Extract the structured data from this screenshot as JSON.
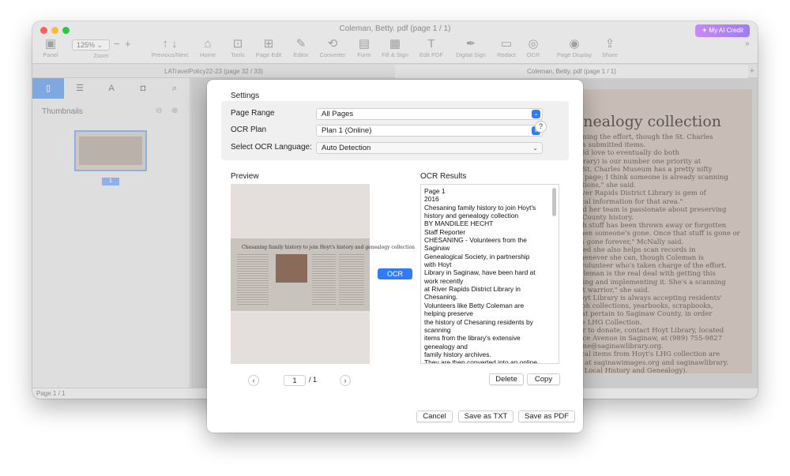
{
  "window": {
    "title": "Coleman, Betty. pdf (page 1 / 1)",
    "ai_credit": "My AI Credit",
    "toolbar": {
      "panel": "Panel",
      "zoom_label": "Zoom",
      "zoom_value": "125%",
      "zoom_minus": "−",
      "zoom_plus": "+",
      "prev_next": "Previous/Next",
      "home": "Home",
      "tools": "Tools",
      "page_edit": "Page Edit",
      "editor": "Editor",
      "converter": "Converter",
      "form": "Form",
      "fill_sign": "Fill & Sign",
      "edit_pdf": "Edit PDF",
      "digital_sign": "Digital Sign",
      "redact": "Redact",
      "ocr": "OCR",
      "page_display": "Page Display",
      "share": "Share"
    },
    "tabs": [
      "LATravelPolicy22-23 (page 32 / 33)",
      "Coleman, Betty. pdf (page 1 / 1)"
    ],
    "tab_add": "+",
    "sidebar": {
      "thumbnails_label": "Thumbnails",
      "thumb_page_number": "1"
    },
    "document": {
      "heading": "enealogy collection",
      "lines": [
        "joining the effort, though the St. Charles",
        "has submitted items.",
        "ould love to eventually do both",
        "library) is our number one priority at",
        "e, St. Charles Museum has a pretty nifty",
        "ok page; I think someone is already scanning",
        "ections,\" she said.",
        "River Rapids District Library is gem of",
        "gical information for that area.\"",
        "and her team is passionate about preserving",
        "w County history.",
        "uch stuff has been thrown away or forgotten",
        "when someone's gone. Once that stuff is gone or",
        "it's gone forever,\" McNally said.",
        "dded she also helps scan records in",
        "whenever she can, though Coleman is",
        "n volunteer who's taken charge of the effort.",
        "Coleman is the real deal with getting this",
        "going and implementing it. She's a scanning",
        "ent warrior,\" she said.",
        "Hoyt Library is always accepting residents'",
        "raph collections, yearbooks, scrapbooks,",
        "that pertain to Saginaw County, in order",
        "the LHG Collection.",
        "der to donate, contact Hoyt Library, located",
        "ance Avenue in Saginaw, at (989) 755-9827",
        "gene@saginawlibrary.org.",
        "gical items from Hoyt's LHG collection are",
        "ed at saginawimages.org and saginawlibrary.",
        "ck Local History and Genealogy)."
      ],
      "ai_badge": "AI"
    },
    "status": "Page 1 / 1"
  },
  "dialog": {
    "settings_title": "Settings",
    "page_range_label": "Page Range",
    "page_range_value": "All Pages",
    "ocr_plan_label": "OCR Plan",
    "ocr_plan_value": "Plan 1 (Online)",
    "language_label": "Select OCR Language:",
    "language_value": "Auto Detection",
    "help": "?",
    "preview_label": "Preview",
    "preview_headline": "Chesaning family history to join Hoyt's history and genealogy collection",
    "ocr_button": "OCR",
    "results_label": "OCR Results",
    "results_text": "Page 1\n2016\nChesaning family history to join Hoyt's\nhistory and genealogy collection\nBY MANDILEE HECHT\nStaff Reporter\nCHESANING - Volunteers from the\nSaginaw\nGenealogical Society, in partnership\nwith Hoyt\nLibrary in Saginaw, have been hard at\nwork recently\nat River Rapids District Library in\nChesaning.\nVolunteers like Betty Coleman are\nhelping preserve\nthe history of Chesaning residents by\nscanning\nitems from the library's extensive\ngenealogy and\nfamily history archives.\nThey are then converted into an online",
    "prev_page": "‹",
    "next_page": "›",
    "page_current": "1",
    "page_total": "/ 1",
    "delete": "Delete",
    "copy": "Copy",
    "cancel": "Cancel",
    "save_txt": "Save as TXT",
    "save_pdf": "Save as PDF"
  },
  "colors": {
    "accent": "#2f7cf6",
    "sidebar_active": "#7fa7e0"
  }
}
